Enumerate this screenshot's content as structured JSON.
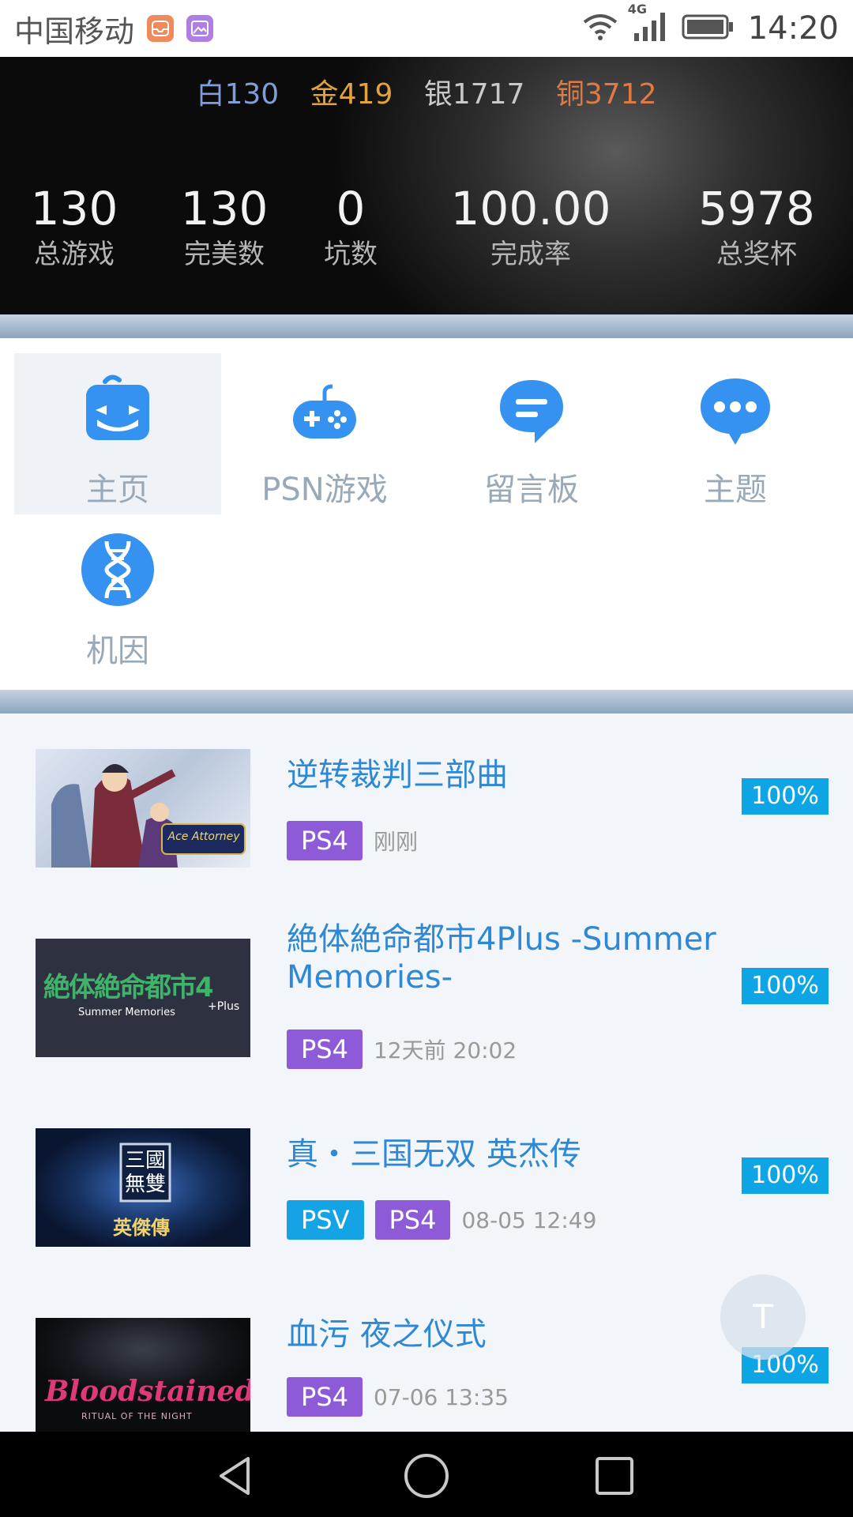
{
  "status_bar": {
    "carrier": "中国移动",
    "network": "4G",
    "time": "14:20"
  },
  "trophies": {
    "platinum": "白130",
    "gold": "金419",
    "silver": "银1717",
    "bronze": "铜3712",
    "colors": {
      "platinum": "#7f9fd9",
      "gold": "#e3a33c",
      "silver": "#c9c9c9",
      "bronze": "#e07a45"
    }
  },
  "stats": [
    {
      "value": "130",
      "label": "总游戏"
    },
    {
      "value": "130",
      "label": "完美数"
    },
    {
      "value": "0",
      "label": "坑数"
    },
    {
      "value": "100.00",
      "label": "完成率"
    },
    {
      "value": "5978",
      "label": "总奖杯"
    }
  ],
  "tabs": [
    {
      "label": "主页",
      "icon": "home-robot-icon",
      "active": true
    },
    {
      "label": "PSN游戏",
      "icon": "gamepad-icon"
    },
    {
      "label": "留言板",
      "icon": "message-bubble-icon"
    },
    {
      "label": "主题",
      "icon": "chat-dots-icon"
    },
    {
      "label": "机因",
      "icon": "dna-icon"
    }
  ],
  "games": [
    {
      "title": "逆转裁判三部曲",
      "platforms": [
        "PS4"
      ],
      "time": "刚刚",
      "progress": "100%"
    },
    {
      "title": "絶体絶命都市4Plus -Summer Memories-",
      "platforms": [
        "PS4"
      ],
      "time": "12天前 20:02",
      "progress": "100%"
    },
    {
      "title": "真・三国无双 英杰传",
      "platforms": [
        "PSV",
        "PS4"
      ],
      "time": "08-05 12:49",
      "progress": "100%"
    },
    {
      "title": "血污 夜之仪式",
      "platforms": [
        "PS4"
      ],
      "time": "07-06 13:35",
      "progress": "100%"
    }
  ],
  "thumbs": {
    "g1": {
      "logo": "Ace Attorney"
    },
    "g2": {
      "logo": "絶体絶命都市4",
      "sub": "Summer Memories",
      "plus": "+Plus"
    },
    "g3": {
      "logo": "三國無雙",
      "sub": "英傑傳"
    },
    "g4": {
      "logo": "Bloodstained",
      "sub": "RITUAL OF THE NIGHT"
    }
  },
  "fab": {
    "label": "T"
  },
  "colors": {
    "accent": "#2f88d4",
    "ps4": "#8e5bd8",
    "psv": "#14a3e4",
    "progress": "#0ea5e5"
  }
}
